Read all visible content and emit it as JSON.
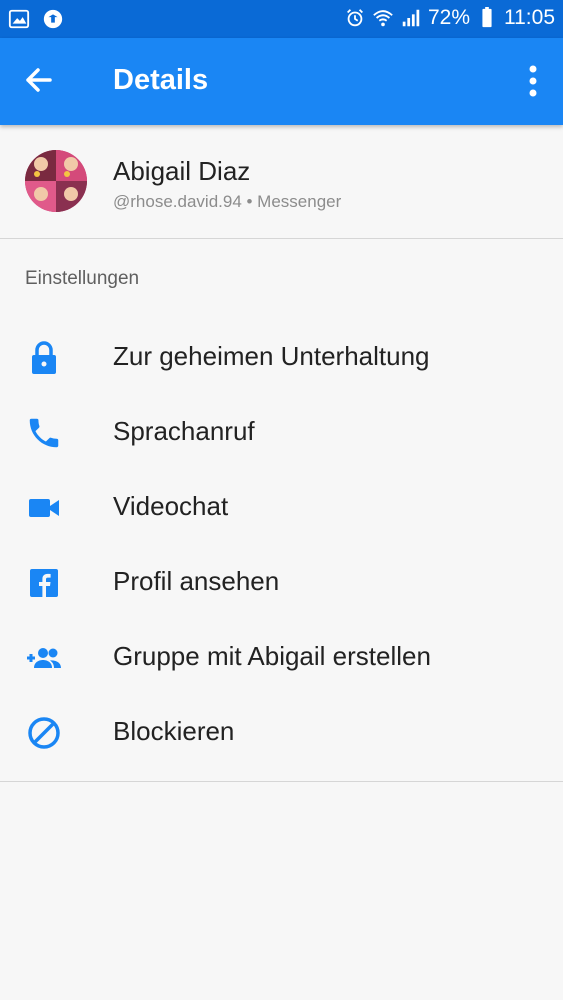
{
  "status_bar": {
    "battery": "72%",
    "time": "11:05"
  },
  "appbar": {
    "title": "Details"
  },
  "profile": {
    "name": "Abigail Diaz",
    "subtitle": "@rhose.david.94 • Messenger"
  },
  "section": {
    "title": "Einstellungen"
  },
  "menu": [
    {
      "icon": "lock-icon",
      "label": "Zur geheimen Unterhaltung"
    },
    {
      "icon": "phone-icon",
      "label": "Sprachanruf"
    },
    {
      "icon": "video-camera-icon",
      "label": "Videochat"
    },
    {
      "icon": "facebook-icon",
      "label": "Profil ansehen"
    },
    {
      "icon": "add-group-icon",
      "label": "Gruppe mit Abigail erstellen"
    },
    {
      "icon": "block-icon",
      "label": "Blockieren"
    }
  ],
  "colors": {
    "status_bar": "#0a6ad6",
    "app_bar": "#1a86f4",
    "icon_blue": "#1a86f4"
  }
}
